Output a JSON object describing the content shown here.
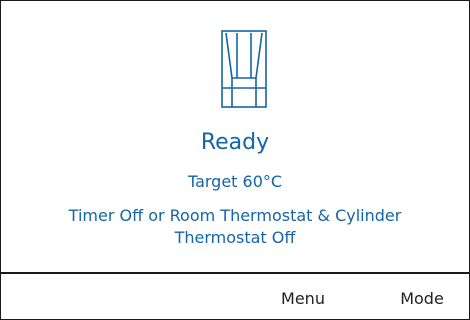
{
  "screen": {
    "icon": "hot-water-cylinder-icon",
    "status": "Ready",
    "target": "Target 60°C",
    "message_line1": "Timer Off or Room Thermostat & Cylinder",
    "message_line2": "Thermostat Off"
  },
  "softkeys": {
    "menu": "Menu",
    "mode": "Mode"
  },
  "colors": {
    "accent": "#1464a8",
    "text": "#222222",
    "border": "#1a1a1a",
    "background": "#ffffff"
  }
}
